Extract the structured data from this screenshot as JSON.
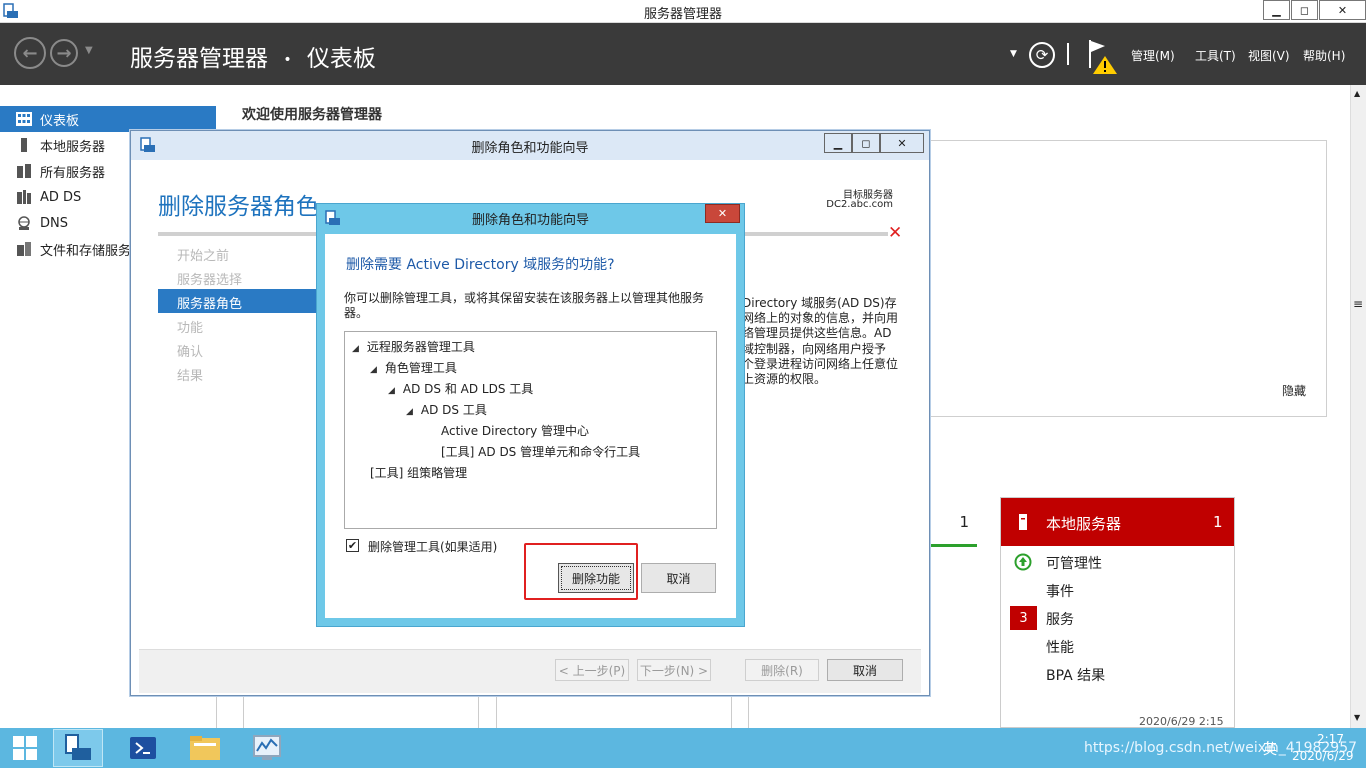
{
  "app": {
    "title": "服务器管理器",
    "window_buttons": {
      "minimize": "▁",
      "restore": "◻",
      "close": "✕"
    }
  },
  "header": {
    "back_arrow": "←",
    "forward_arrow": "→",
    "app_name": "服务器管理器",
    "separator": "•",
    "page": "仪表板",
    "refresh": "⟳",
    "menu": {
      "manage": "管理(M)",
      "tools": "工具(T)",
      "view": "视图(V)",
      "help": "帮助(H)"
    }
  },
  "sidebar": {
    "items": [
      {
        "label": "仪表板"
      },
      {
        "label": "本地服务器"
      },
      {
        "label": "所有服务器"
      },
      {
        "label": "AD DS"
      },
      {
        "label": "DNS"
      },
      {
        "label": "文件和存储服务"
      }
    ]
  },
  "main": {
    "welcome": "欢迎使用服务器管理器",
    "hide_link": "隐藏",
    "ad_tile_count": "1",
    "local_tile": {
      "title": "本地服务器",
      "count": "1",
      "rows": [
        "可管理性",
        "事件",
        "服务",
        "性能",
        "BPA 结果"
      ],
      "services_badge": "3",
      "timestamp": "2020/6/29 2:15"
    }
  },
  "wizard": {
    "title": "删除角色和功能向导",
    "heading": "删除服务器角色",
    "target_label": "目标服务器",
    "target_value": "DC2.abc.com",
    "steps": [
      "开始之前",
      "服务器选择",
      "服务器角色",
      "功能",
      "确认",
      "结果"
    ],
    "description_lines": [
      "Directory 域服务(AD DS)存",
      "网络上的对象的信息，并向用",
      "络管理员提供这些信息。AD",
      "域控制器，向网络用户授予",
      "个登录进程访问网络上任意位",
      "上资源的权限。"
    ],
    "buttons": {
      "prev": "< 上一步(P)",
      "next": "下一步(N) >",
      "remove": "删除(R)",
      "cancel": "取消"
    },
    "x_mark": "✕"
  },
  "dialog": {
    "title": "删除角色和功能向导",
    "heading": "删除需要 Active Directory 域服务的功能?",
    "text": "你可以删除管理工具，或将其保留安装在该服务器上以管理其他服务器。",
    "tree": [
      {
        "label": "远程服务器管理工具",
        "expanded": true,
        "level": 0
      },
      {
        "label": "角色管理工具",
        "expanded": true,
        "level": 1
      },
      {
        "label": "AD DS 和 AD LDS 工具",
        "expanded": true,
        "level": 2
      },
      {
        "label": "AD DS 工具",
        "expanded": true,
        "level": 3
      },
      {
        "label": "Active Directory 管理中心",
        "expanded": false,
        "level": 4
      },
      {
        "label": "[工具] AD DS 管理单元和命令行工具",
        "expanded": false,
        "level": 4
      },
      {
        "label": "[工具] 组策略管理",
        "expanded": false,
        "level": 0
      }
    ],
    "checkbox_label": "删除管理工具(如果适用)",
    "checkbox_checked": true,
    "remove_button": "删除功能",
    "cancel_button": "取消",
    "close_glyph": "✕"
  },
  "taskbar": {
    "watermark": "https://blog.csdn.net/weixin_41982957",
    "ime": "英",
    "time": "2:17",
    "date": "2020/6/29"
  },
  "colors": {
    "header_bg": "#3a3a3a",
    "sidebar_active": "#2a7ac4",
    "tile_red": "#c00000",
    "dialog_border": "#6ec8e8",
    "taskbar": "#5cb7e0",
    "highlight_box": "#e02020"
  }
}
